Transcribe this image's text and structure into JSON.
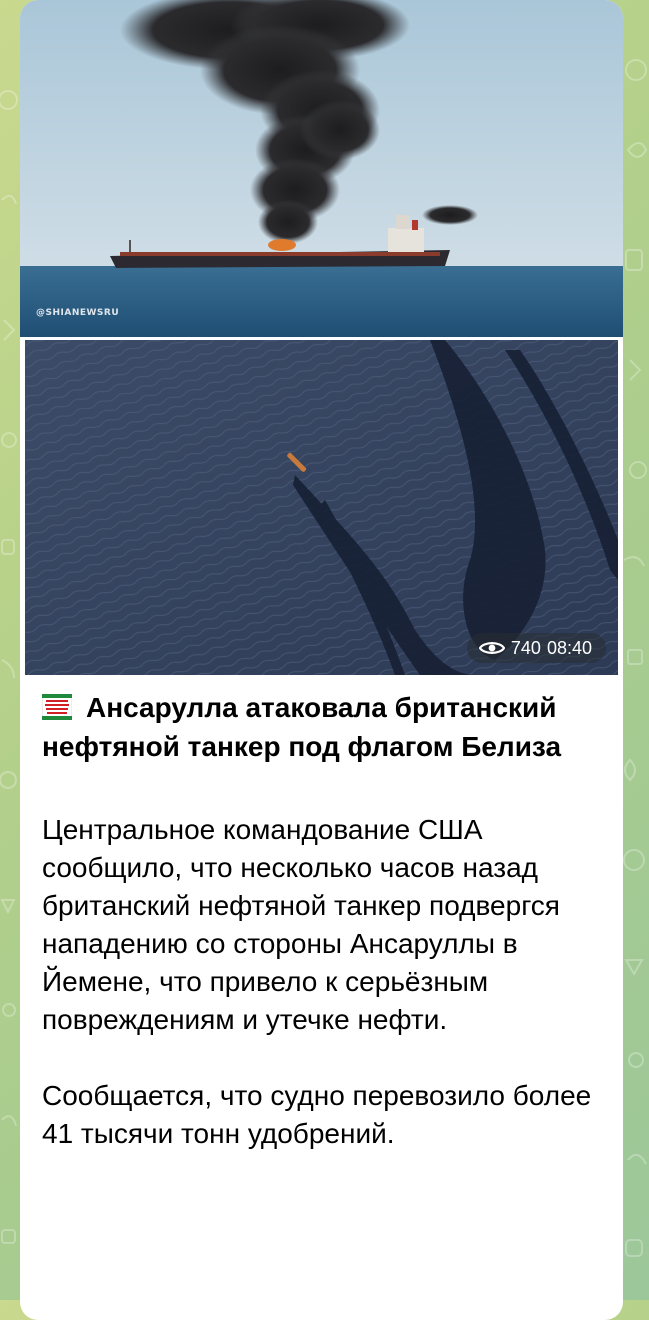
{
  "post": {
    "photo_top": {
      "watermark": "@SHIANEWSRU"
    },
    "photo_bottom": {
      "views": "740",
      "time": "08:40"
    },
    "title": "Ансарулла атаковала британский нефтяной танкер под флагом Белиза",
    "paragraphs": [
      "Центральное командование США сообщило, что несколько часов назад британский нефтяной танкер подвергся нападению со стороны Ансаруллы в Йемене, что привело к серьёзным повреждениям и утечке нефти.",
      "Сообщается, что судно перевозило более 41 тысячи тонн удобрений."
    ]
  },
  "icons": {
    "views": "eye-icon",
    "title_prefix": "flag-icon"
  },
  "colors": {
    "wallpaper": "#b8d28a",
    "bubble": "#ffffff",
    "flag_green": "#1f8a3b",
    "flag_red": "#d21f26",
    "pill_bg": "rgba(40,45,50,0.55)"
  }
}
